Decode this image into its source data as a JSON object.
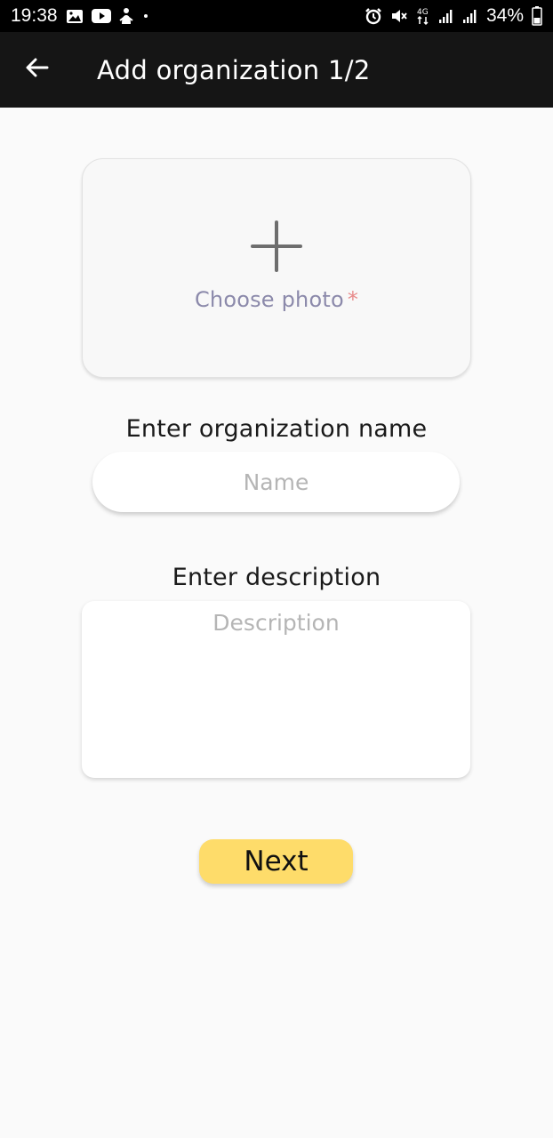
{
  "status_bar": {
    "time": "19:38",
    "left_icons": [
      "gallery-icon",
      "youtube-icon",
      "notification-icon",
      "dot-icon"
    ],
    "right_icons": [
      "alarm-icon",
      "mute-icon",
      "4g-icon",
      "signal-icon",
      "signal-icon-2",
      "battery-icon"
    ],
    "network": "4G",
    "battery": "34%"
  },
  "app_bar": {
    "title": "Add organization 1/2",
    "back_icon": "arrow-left-icon"
  },
  "photo_picker": {
    "icon": "plus-icon",
    "label": "Choose photo",
    "required_mark": "*"
  },
  "name_field": {
    "label": "Enter organization name",
    "placeholder": "Name",
    "value": ""
  },
  "description_field": {
    "label": "Enter description",
    "placeholder": "Description",
    "value": ""
  },
  "next_button": {
    "label": "Next",
    "color": "#fedc6a"
  },
  "colors": {
    "app_bar": "#151515",
    "background": "#fafafa",
    "photo_label": "#8c8aab",
    "required": "#e88a8a"
  }
}
